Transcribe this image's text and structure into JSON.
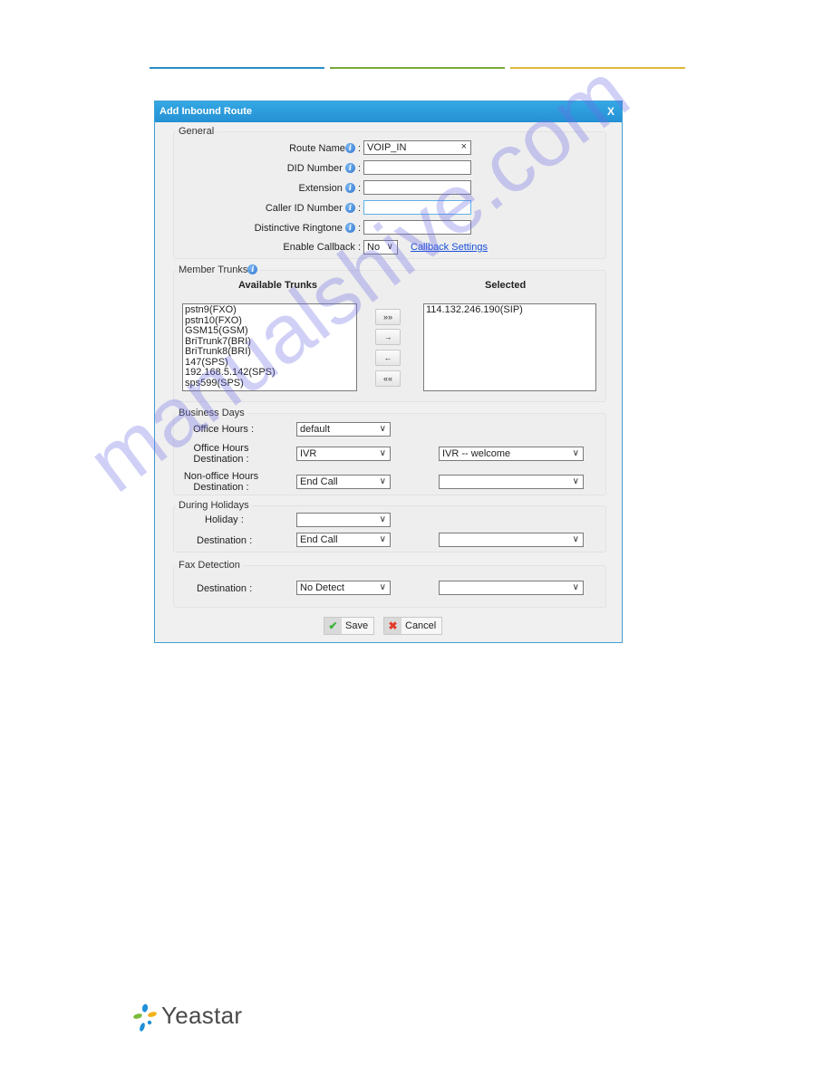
{
  "page": {
    "header_line_colors": [
      "#2a8fc6",
      "#7aaa3a",
      "#e0b83a"
    ],
    "watermark": "manualshive.com",
    "logo_text": "Yeastar"
  },
  "dialog": {
    "title": "Add Inbound Route",
    "close_label": "X",
    "accent_color": "#2b9bdc",
    "general": {
      "legend": "General",
      "route_name_label": "Route Name",
      "route_name_value": "VOIP_IN",
      "did_number_label": "DID Number",
      "did_number_value": "",
      "extension_label": "Extension",
      "extension_value": "",
      "caller_id_label": "Caller ID Number",
      "caller_id_value": "",
      "ringtone_label": "Distinctive Ringtone",
      "ringtone_value": "",
      "enable_callback_label": "Enable Callback :",
      "enable_callback_value": "No",
      "callback_settings_link": "Callback Settings",
      "colon": ":"
    },
    "member_trunks": {
      "legend": "Member Trunks",
      "available_header": "Available Trunks",
      "selected_header": "Selected",
      "available": [
        "pstn9(FXO)",
        "pstn10(FXO)",
        "GSM15(GSM)",
        "BriTrunk7(BRI)",
        "BriTrunk8(BRI)",
        "147(SPS)",
        "192.168.5.142(SPS)",
        "sps599(SPS)"
      ],
      "selected": [
        "114.132.246.190(SIP)"
      ],
      "buttons": {
        "add_all": "»»",
        "add": "→",
        "remove": "←",
        "remove_all": "««"
      }
    },
    "business_days": {
      "legend": "Business Days",
      "office_hours_label": "Office Hours :",
      "office_hours_value": "default",
      "office_dest_label_1": "Office Hours",
      "office_dest_label_2": "Destination :",
      "office_dest_value": "IVR",
      "office_dest_target": "IVR -- welcome",
      "nonoffice_label_1": "Non-office Hours",
      "nonoffice_label_2": "Destination :",
      "nonoffice_value": "End Call",
      "nonoffice_target": ""
    },
    "holidays": {
      "legend": "During Holidays",
      "holiday_label": "Holiday :",
      "holiday_value": "",
      "destination_label": "Destination :",
      "destination_value": "End Call",
      "destination_target": ""
    },
    "fax": {
      "legend": "Fax Detection",
      "destination_label": "Destination :",
      "destination_value": "No Detect",
      "destination_target": ""
    },
    "save_label": "Save",
    "cancel_label": "Cancel"
  }
}
